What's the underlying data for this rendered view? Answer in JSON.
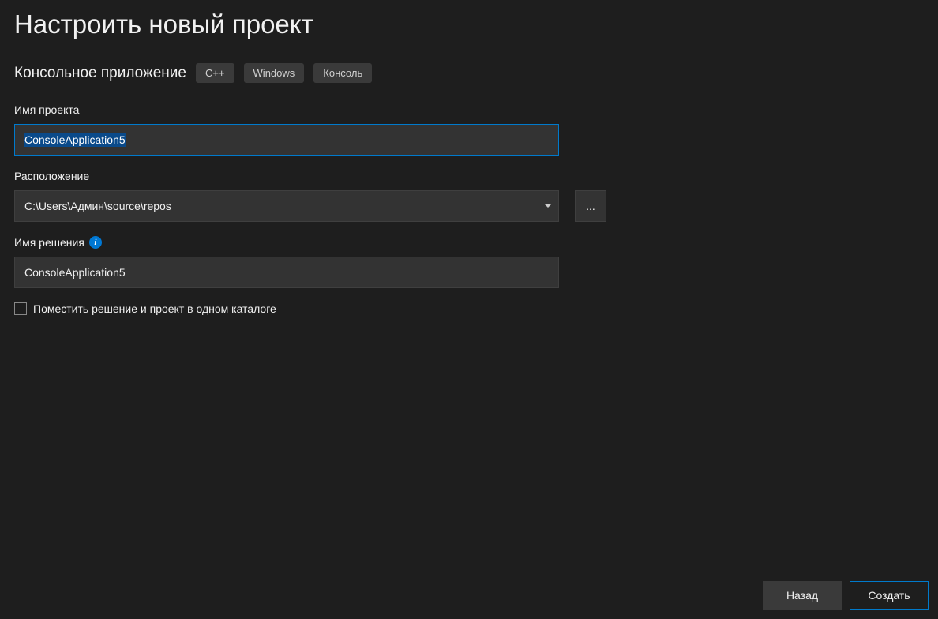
{
  "header": {
    "title": "Настроить новый проект",
    "subtitle": "Консольное приложение",
    "tags": [
      "C++",
      "Windows",
      "Консоль"
    ]
  },
  "form": {
    "project_name": {
      "label": "Имя проекта",
      "value": "ConsoleApplication5"
    },
    "location": {
      "label": "Расположение",
      "value": "C:\\Users\\Админ\\source\\repos",
      "browse_label": "..."
    },
    "solution_name": {
      "label": "Имя решения",
      "value": "ConsoleApplication5"
    },
    "same_directory_checkbox": {
      "label": "Поместить решение и проект в одном каталоге",
      "checked": false
    }
  },
  "footer": {
    "back_label": "Назад",
    "create_label": "Создать"
  }
}
